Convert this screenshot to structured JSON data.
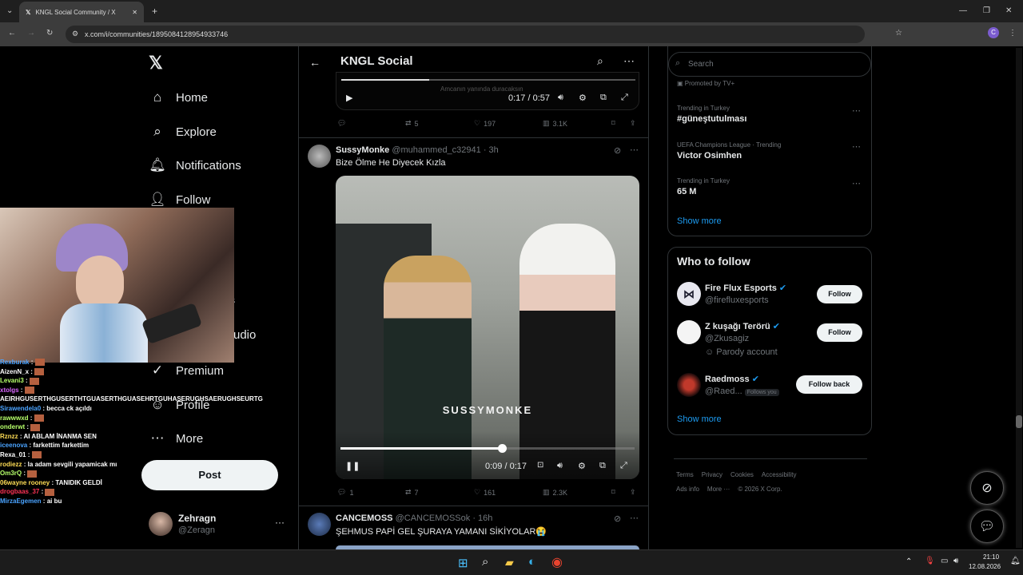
{
  "browser": {
    "tab_title": "KNGL Social Community / X",
    "tab_close": "✕",
    "new_tab": "+",
    "url": "x.com/i/communities/1895084128954933746",
    "win_controls": [
      "—",
      "❐",
      "✕"
    ]
  },
  "nav": {
    "items": [
      "Home",
      "Explore",
      "Notifications",
      "Follow",
      "s",
      "udio",
      "Premium",
      "Profile",
      "More"
    ],
    "post_label": "Post",
    "account_name": "Zehragn",
    "account_handle": "@Zeragn",
    "more_dots": "···"
  },
  "header": {
    "title": "KNGL Social"
  },
  "tweet1": {
    "caption": "Amcanın yanında duracaksın",
    "time": "0:17 / 0:57",
    "stats": {
      "replies": "",
      "retweets": "5",
      "likes": "197",
      "views": "3.1K"
    }
  },
  "tweet2": {
    "name": "SussyMonke",
    "handle": "@muhammed_c32941 · 3h",
    "text": "Bize Ölme He Diyecek Kızla",
    "watermark": "SUSSYMONKE",
    "time": "0:09 / 0:17",
    "progress": 0.55,
    "stats": {
      "replies": "1",
      "retweets": "7",
      "likes": "161",
      "views": "2.3K"
    }
  },
  "tweet3": {
    "name": "CANCEMOSS",
    "handle": "@CANCEMOSSok · 16h",
    "text": "ŞEHMUS PAPİ GEL ŞURAYA YAMANI SİKİYOLAR😭"
  },
  "right": {
    "search_placeholder": "Search",
    "promoted": "Promoted by TV+",
    "trends": [
      {
        "context": "Trending in Turkey",
        "name": "#güneştutulması"
      },
      {
        "context": "UEFA Champions League · Trending",
        "name": "Victor Osimhen"
      },
      {
        "context": "Trending in Turkey",
        "name": "65 M"
      }
    ],
    "show_more": "Show more",
    "who_title": "Who to follow",
    "who": [
      {
        "name": "Fire Flux Esports",
        "handle": "@firefluxesports",
        "btn": "Follow",
        "extra": ""
      },
      {
        "name": "Z kuşağı Terörü",
        "handle": "@Zkusagiz",
        "btn": "Follow",
        "extra": "Parody account"
      },
      {
        "name": "Raedmoss",
        "handle": "@Raed...",
        "btn": "Follow back",
        "extra": "Follows you"
      }
    ],
    "show_more2": "Show more",
    "footer1": [
      "Terms",
      "Privacy",
      "Cookies",
      "Accessibility"
    ],
    "footer2": [
      "Ads info",
      "More ···",
      "© 2026 X Corp."
    ]
  },
  "chat": [
    {
      "user": "Rexburak",
      "msg": "",
      "color": "#4aa3ff"
    },
    {
      "user": "AizenN_x",
      "msg": "",
      "color": "#ffffff"
    },
    {
      "user": "Levani3",
      "msg": "",
      "color": "#b6ff6a"
    },
    {
      "user": "xtolgs",
      "msg": "",
      "color": "#d966ff"
    },
    {
      "user": "",
      "msg": "AEIRHGUSERTHGUSERTHTGUASERTHGUASEHRTGUHASERUGHSAERUGHSEURTG",
      "color": "#ffffff"
    },
    {
      "user": "Sirawendela0",
      "msg": "becca ck açıldı",
      "color": "#4aa3ff"
    },
    {
      "user": "rawwwxd",
      "msg": "",
      "color": "#b6ff6a"
    },
    {
      "user": "onderwt",
      "msg": "",
      "color": "#b6ff6a"
    },
    {
      "user": "Rznzz",
      "msg": "AI ABLAM İNANMA SEN",
      "color": "#ffdd55"
    },
    {
      "user": "iceenova",
      "msg": "farkettim farkettim",
      "color": "#4aa3ff"
    },
    {
      "user": "Rexa_01",
      "msg": "",
      "color": "#ffffff"
    },
    {
      "user": "rodiezz",
      "msg": "la adam sevgili yapamicak mı",
      "color": "#ffdd55"
    },
    {
      "user": "Om3rQ",
      "msg": "",
      "color": "#b6ff6a"
    },
    {
      "user": "06wayne rooney",
      "msg": "TANIDIK GELDİ",
      "color": "#ffdd55"
    },
    {
      "user": "drogbaas_37",
      "msg": "",
      "color": "#ff3355"
    },
    {
      "user": "MirzaEgemen",
      "msg": "ai bu",
      "color": "#4aa3ff"
    }
  ],
  "taskbar": {
    "time": "21:10",
    "date": "12.08.2026"
  }
}
